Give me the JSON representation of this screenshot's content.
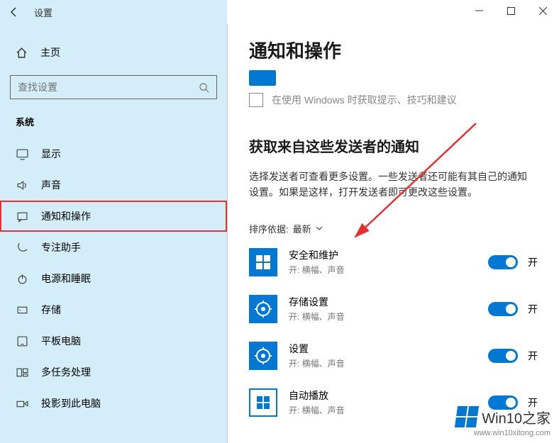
{
  "app_title": "设置",
  "window_controls": {
    "min": "–",
    "max": "▢",
    "close": "✕"
  },
  "home_label": "主页",
  "search_placeholder": "查找设置",
  "section_label": "系统",
  "nav": [
    {
      "key": "display",
      "label": "显示"
    },
    {
      "key": "sound",
      "label": "声音"
    },
    {
      "key": "notifications",
      "label": "通知和操作",
      "highlight": true
    },
    {
      "key": "focus",
      "label": "专注助手"
    },
    {
      "key": "power",
      "label": "电源和睡眠"
    },
    {
      "key": "storage",
      "label": "存储"
    },
    {
      "key": "tablet",
      "label": "平板电脑"
    },
    {
      "key": "multitask",
      "label": "多任务处理"
    },
    {
      "key": "project",
      "label": "投影到此电脑"
    }
  ],
  "page_title": "通知和操作",
  "checkbox_text": "在使用 Windows 时获取提示、技巧和建议",
  "subhead": "获取来自这些发送者的通知",
  "description": "选择发送者可查看更多设置。一些发送者还可能有其自己的通知设置。如果是这样，打开发送者即可更改这些设置。",
  "sort_label": "排序依据:",
  "sort_value": "最新",
  "senders": [
    {
      "name": "安全和维护",
      "sub": "开: 横幅、声音",
      "state": "开"
    },
    {
      "name": "存储设置",
      "sub": "开: 横幅、声音",
      "state": "开"
    },
    {
      "name": "设置",
      "sub": "开: 横幅、声音",
      "state": "开"
    },
    {
      "name": "自动播放",
      "sub": "开: 横幅、声音",
      "state": "开"
    }
  ],
  "watermark": {
    "brand": "Win10",
    "suffix": "之家",
    "url": "www.win10xitong.com"
  }
}
